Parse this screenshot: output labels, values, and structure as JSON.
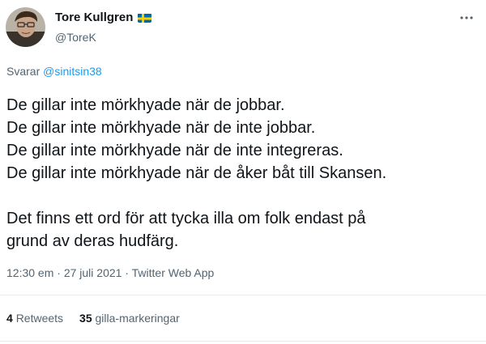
{
  "author": {
    "name": "Tore Kullgren",
    "handle": "@ToreK",
    "flag": "sweden-flag-icon"
  },
  "reply": {
    "prefix": "Svarar",
    "mention": "@sinitsin38"
  },
  "tweet": {
    "lines": [
      "De gillar inte mörkhyade när de jobbar.",
      "De gillar inte mörkhyade när de inte jobbar.",
      "De gillar inte mörkhyade när de inte integreras.",
      "De gillar inte mörkhyade när de åker båt till Skansen."
    ],
    "paragraph2": [
      "Det finns ett ord för att tycka illa om folk endast på",
      "grund av deras hudfärg."
    ]
  },
  "meta": {
    "time": "12:30 em",
    "separator": "·",
    "date": "27 juli 2021",
    "source": "Twitter Web App"
  },
  "stats": {
    "retweets_count": "4",
    "retweets_label": "Retweets",
    "likes_count": "35",
    "likes_label": "gilla-markeringar"
  },
  "colors": {
    "text": "#0f1419",
    "secondary": "#536471",
    "link": "#1d9bf0",
    "divider": "#e6ecf0"
  },
  "icons": {
    "more": "more-horizontal-icon"
  }
}
